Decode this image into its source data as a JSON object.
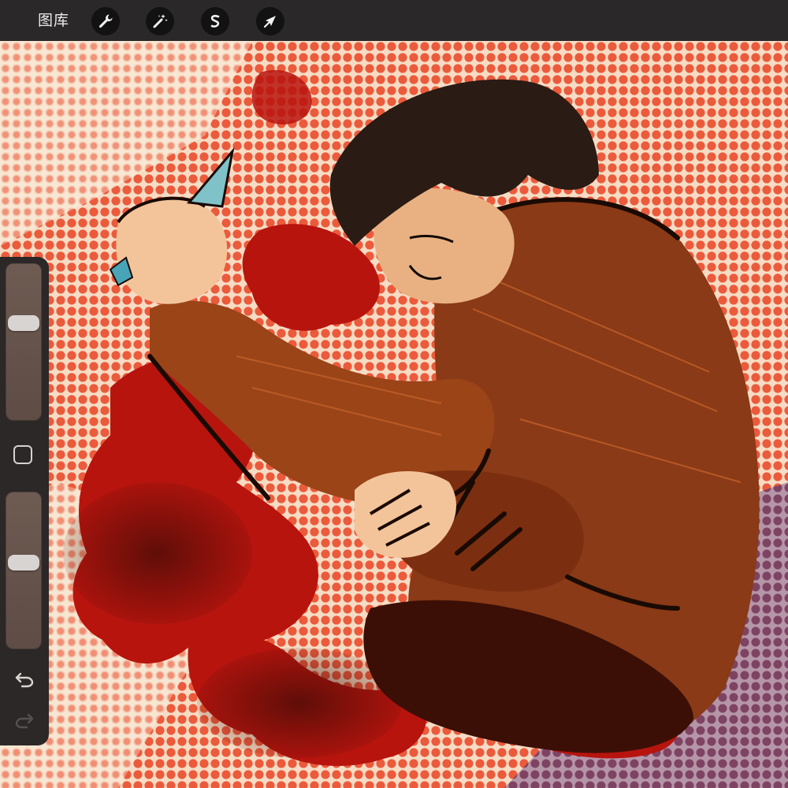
{
  "app": {
    "gallery_label": "图库"
  },
  "toolbar": {
    "tools": [
      {
        "name": "actions",
        "icon": "wrench-icon"
      },
      {
        "name": "adjustments",
        "icon": "magic-wand-icon"
      },
      {
        "name": "selection",
        "icon": "selection-s-icon"
      },
      {
        "name": "transform",
        "icon": "arrow-cursor-icon"
      }
    ]
  },
  "sidebar": {
    "brush_size_level": 0.64,
    "opacity_level": 0.56,
    "modify_button_icon": "square-icon",
    "undo_icon": "undo-arrow-icon",
    "redo_icon": "redo-arrow-icon"
  },
  "colors": {
    "toolbar_bg": "#2a2828",
    "canvas_halftone": "#e8533a",
    "blood_red": "#b8140e",
    "sweater_brown": "#8a3a16",
    "hair_dark": "#2a1b14",
    "skin": "#f3c49a"
  }
}
